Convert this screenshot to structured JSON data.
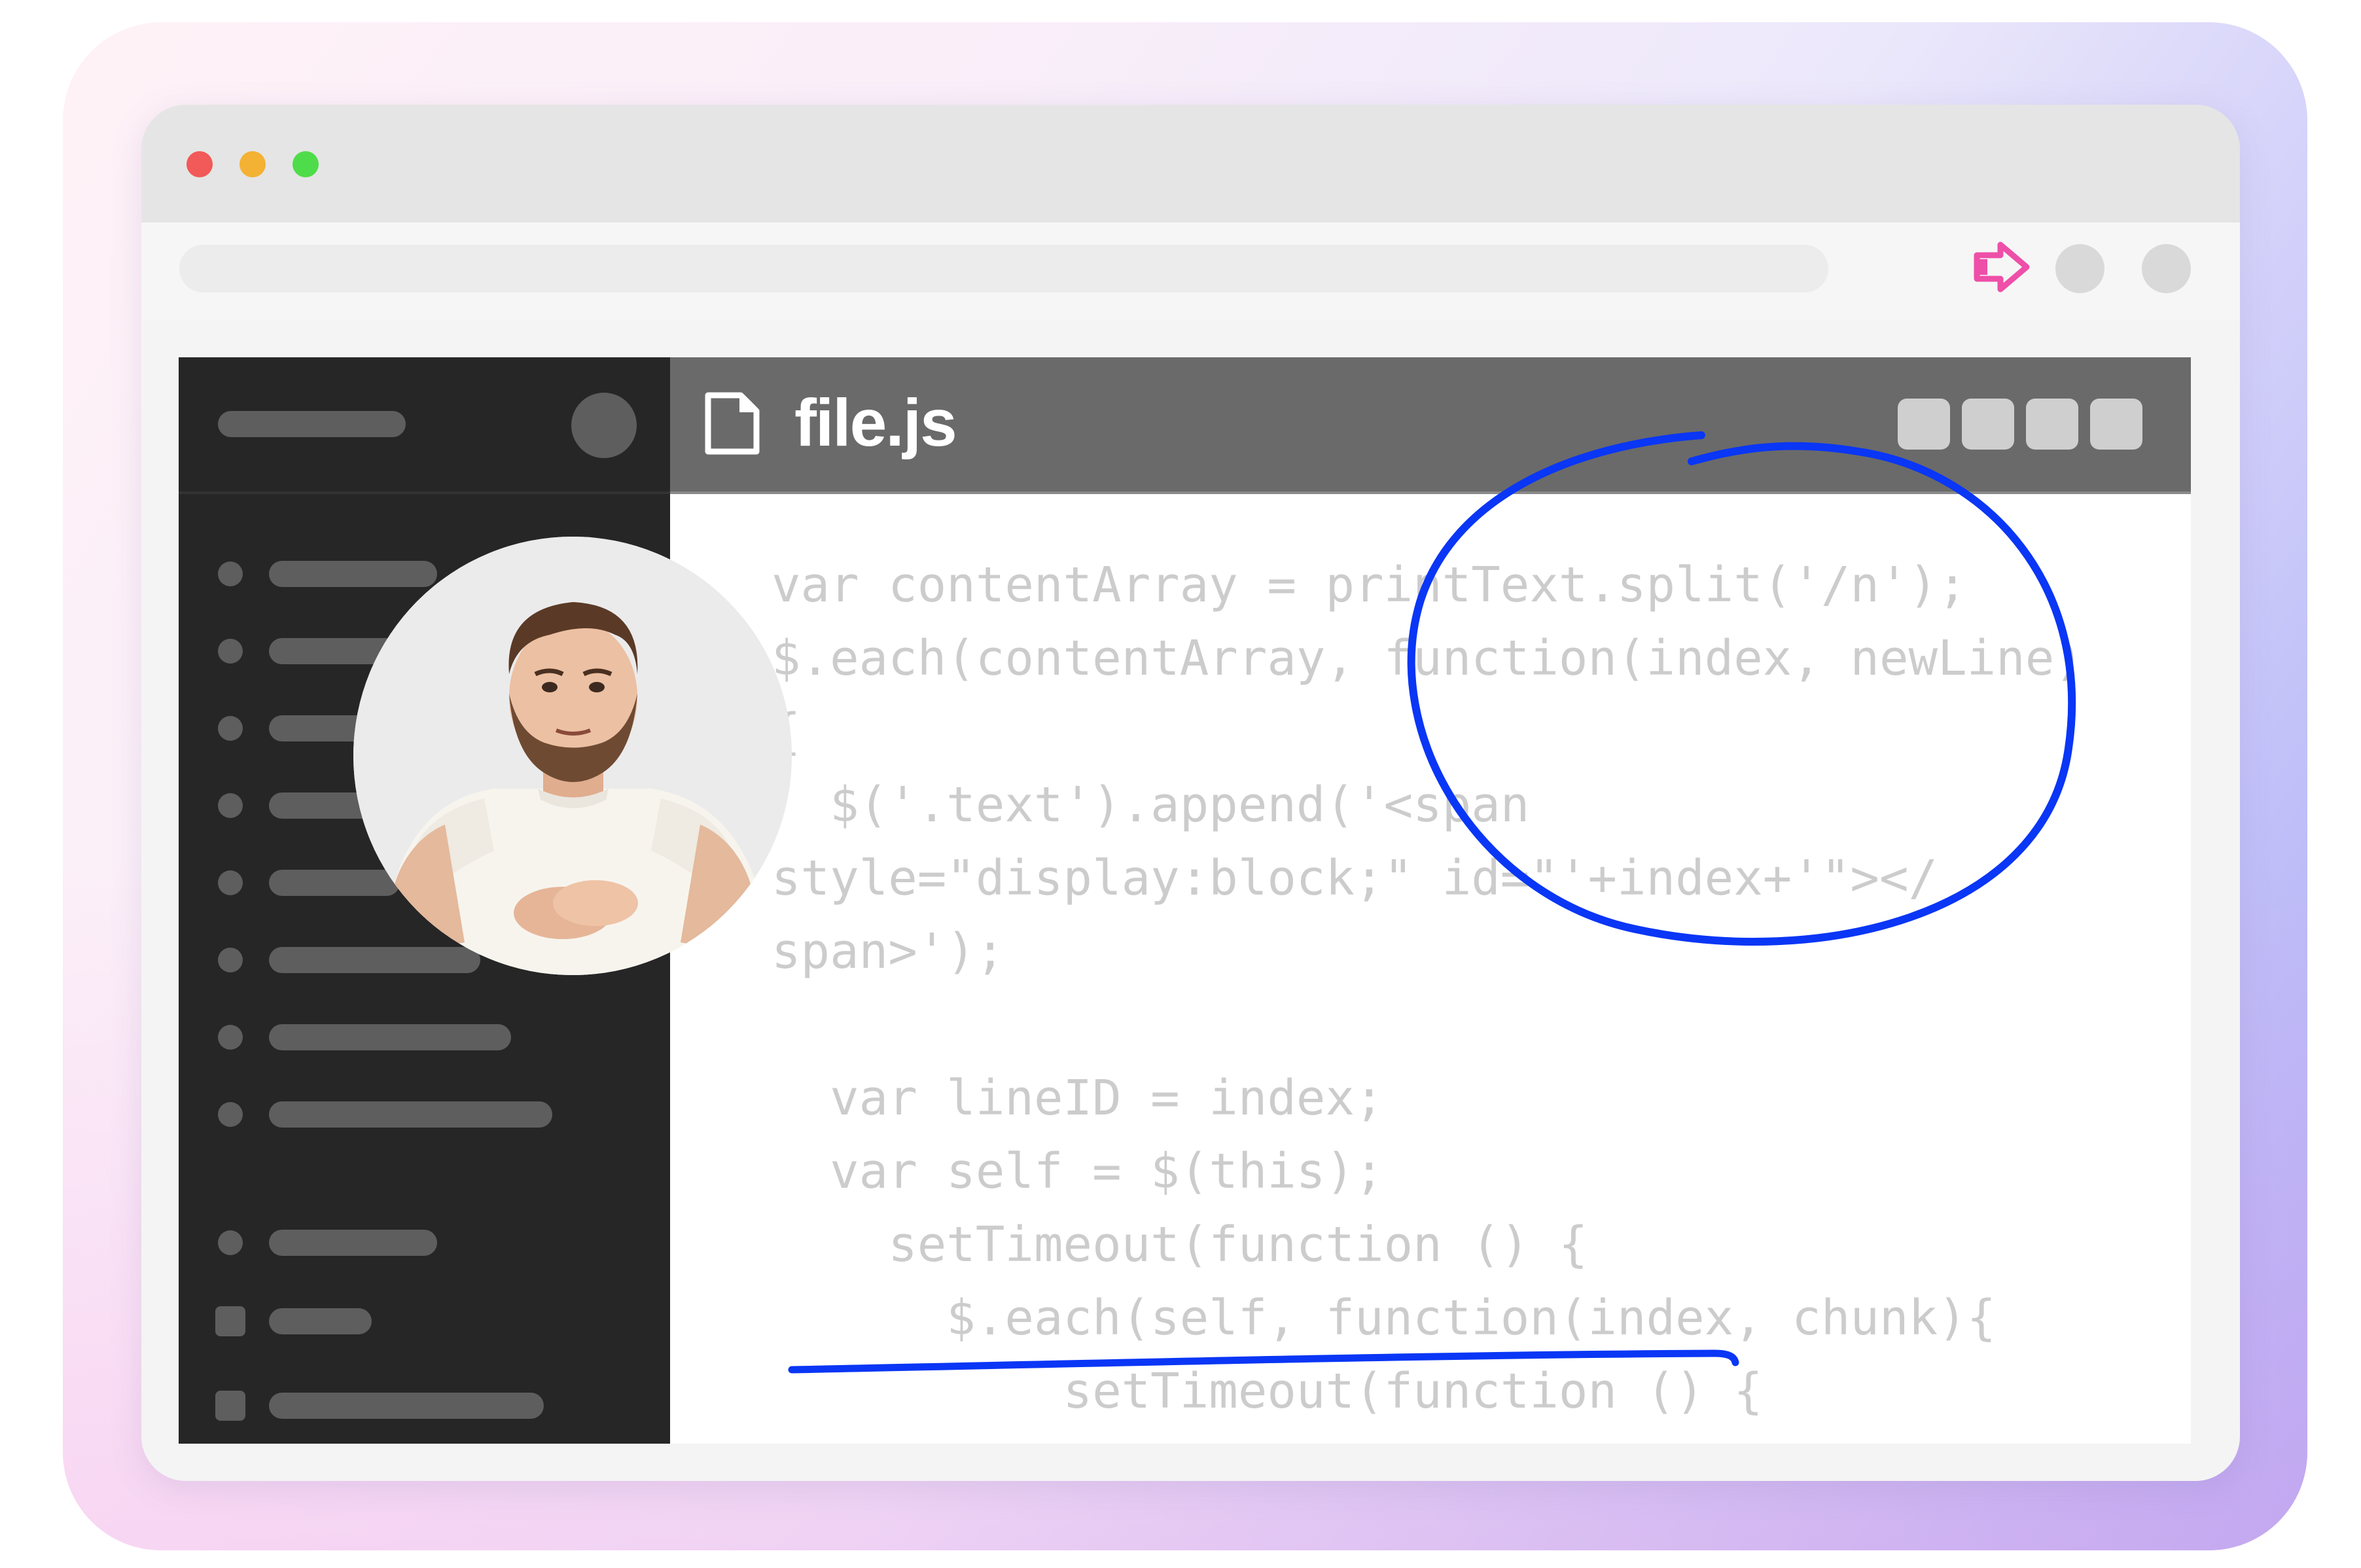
{
  "window": {
    "traffic_lights": [
      "close",
      "minimize",
      "maximize"
    ],
    "colors": {
      "close": "#f15a58",
      "minimize": "#f3b234",
      "maximize": "#4fdc4a"
    }
  },
  "toolbar": {
    "extension_icon": "arrow-right-icon",
    "extension_color": "#ee4fa8"
  },
  "editor": {
    "filename": "file.js",
    "file_icon": "file-icon",
    "code_lines": [
      "var contentArray = printText.split('/n');",
      "$.each(contentArray, function(index, newLine)",
      "{",
      "  $('.text').append('<span",
      "style=\"display:block;\" id=\"'+index+'\"></",
      "span>');",
      "",
      "  var lineID = index;",
      "  var self = $(this);",
      "    setTimeout(function () {",
      "      $.each(self, function(index, chunk){",
      "          setTimeout(function () {"
    ]
  },
  "annotations": {
    "color": "#0a36f5",
    "shapes": [
      "circle",
      "underline"
    ]
  },
  "webcam": {
    "subject": "presenter-avatar"
  }
}
